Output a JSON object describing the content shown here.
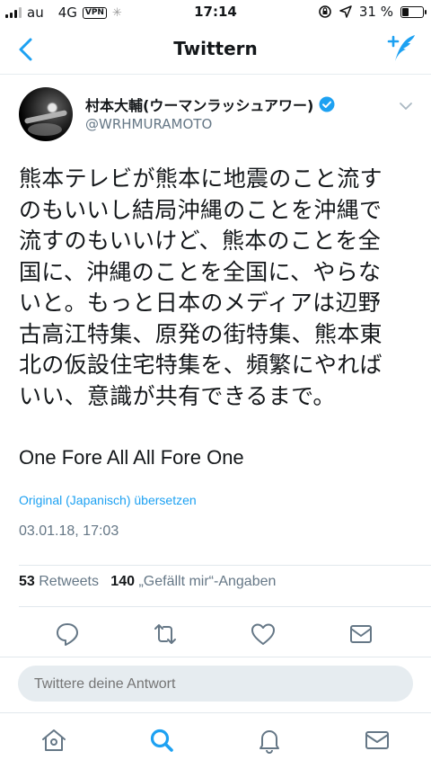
{
  "status_bar": {
    "carrier": "au",
    "network": "4G",
    "vpn": "VPN",
    "time": "17:14",
    "battery": "31 %"
  },
  "navbar": {
    "title": "Twittern"
  },
  "tweet": {
    "author_name": "村本大輔(ウーマンラッシュアワー)",
    "handle": "@WRHMURAMOTO",
    "text_lines": [
      "熊本テレビが熊本に地震のこと流す",
      "のもいいし結局沖縄のことを沖縄で",
      "流すのもいいけど、熊本のことを全",
      "国に、沖縄のことを全国に、やらな",
      "いと。もっと日本のメディアは辺野",
      "古高江特集、原発の街特集、熊本東",
      "北の仮設住宅特集を、頻繁にやれば",
      "いい、意識が共有できるまで。"
    ],
    "latin_line": "One Fore All All Fore One",
    "translate_link": "Original (Japanisch) übersetzen",
    "timestamp": "03.01.18, 17:03",
    "retweet_count": "53",
    "retweet_label": "Retweets",
    "like_count": "140",
    "like_label": "„Gefällt mir“-Angaben"
  },
  "reply": {
    "placeholder": "Twittere deine Antwort"
  },
  "colors": {
    "accent": "#1da1f2",
    "muted": "#657786",
    "divider": "#e1e8ed"
  }
}
